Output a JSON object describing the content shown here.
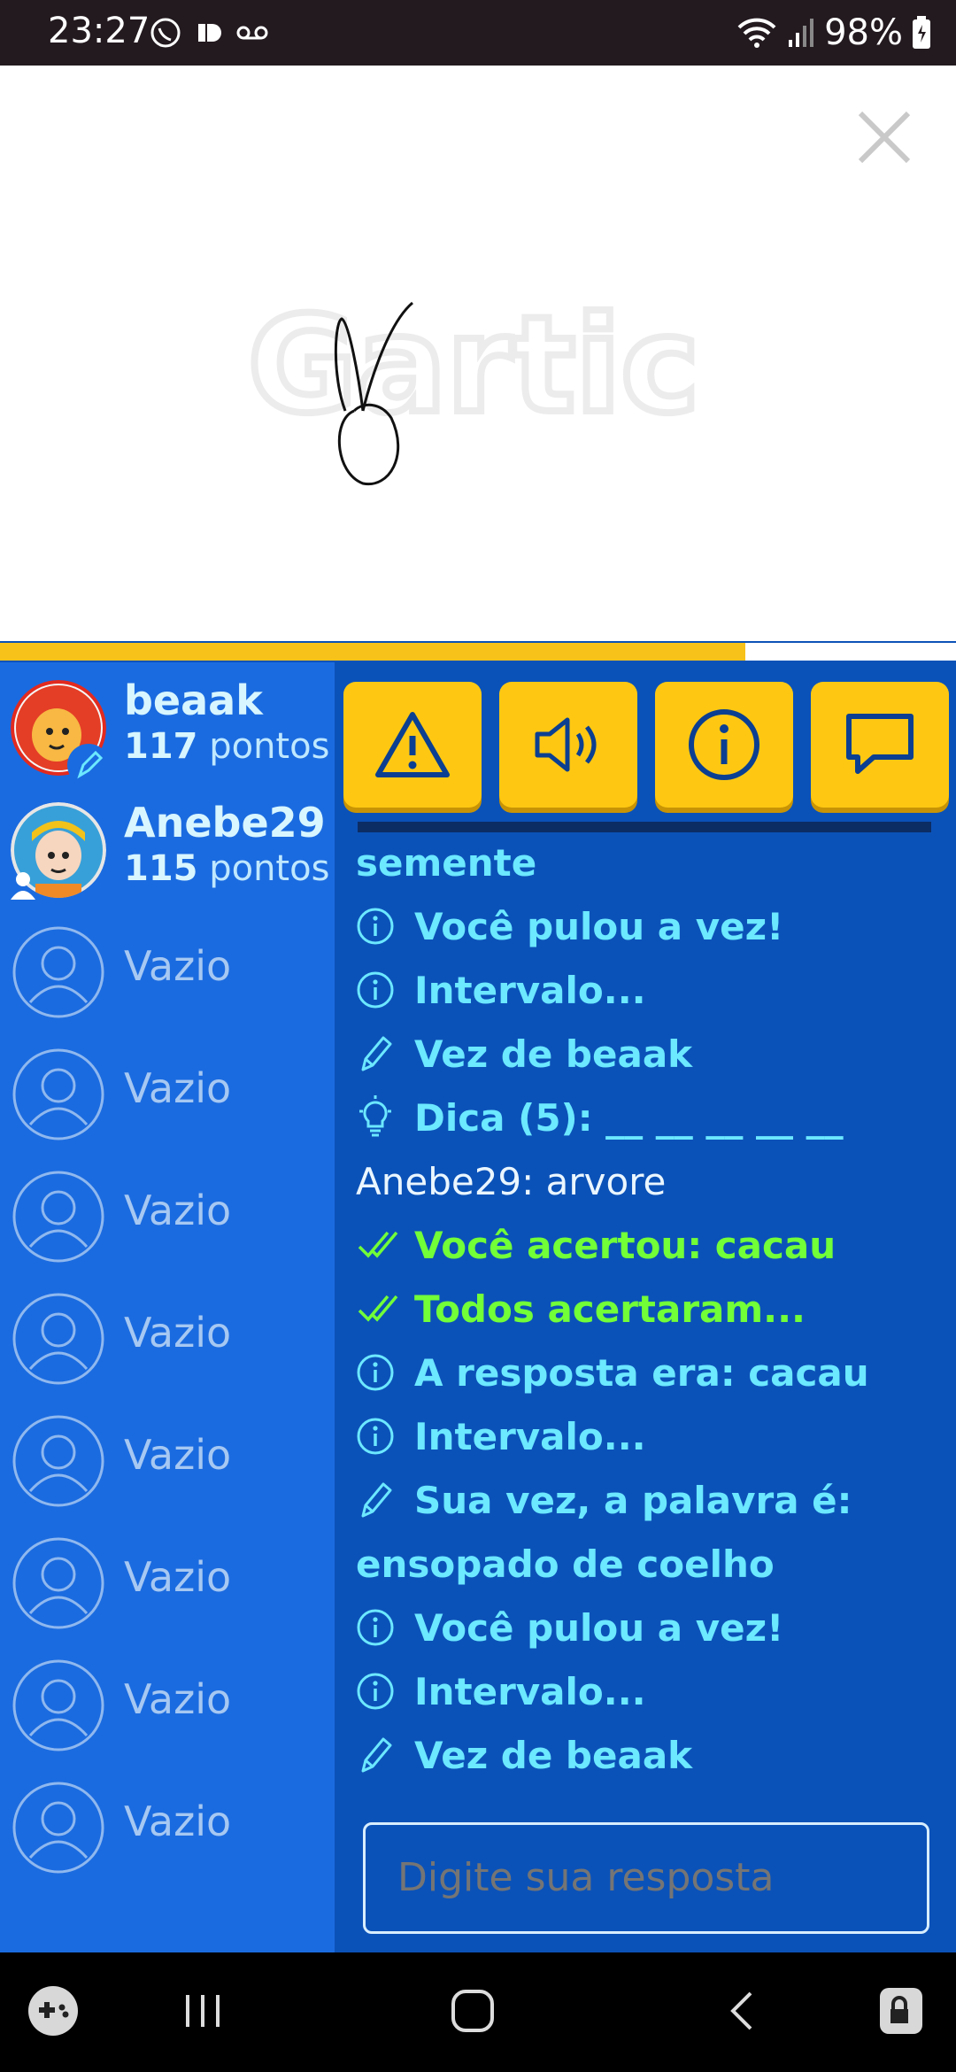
{
  "status_bar": {
    "time": "23:27",
    "battery": "98%"
  },
  "canvas": {
    "watermark": "Gartic"
  },
  "timer": {
    "remaining_fraction": 0.78
  },
  "players": [
    {
      "name": "beaak",
      "score": "117",
      "score_label": "pontos",
      "role": "drawer"
    },
    {
      "name": "Anebe29",
      "score": "115",
      "score_label": "pontos",
      "role": "guesser"
    },
    {
      "name": "Vazio"
    },
    {
      "name": "Vazio"
    },
    {
      "name": "Vazio"
    },
    {
      "name": "Vazio"
    },
    {
      "name": "Vazio"
    },
    {
      "name": "Vazio"
    },
    {
      "name": "Vazio"
    },
    {
      "name": "Vazio"
    }
  ],
  "toolbar": {
    "buttons": [
      "warning-icon",
      "sound-icon",
      "info-icon",
      "chat-icon"
    ]
  },
  "chat": {
    "messages": [
      {
        "icon": "",
        "text": "semente",
        "style": "cont"
      },
      {
        "icon": "info",
        "text": "Você pulou a vez!"
      },
      {
        "icon": "info",
        "text": "Intervalo..."
      },
      {
        "icon": "pencil",
        "text": "Vez de beaak"
      },
      {
        "icon": "bulb",
        "text": "Dica (5): __ __ __ __ __"
      },
      {
        "icon": "",
        "text": "Anebe29: arvore",
        "style": "plain"
      },
      {
        "icon": "check",
        "text": "Você acertou: cacau",
        "style": "green"
      },
      {
        "icon": "check",
        "text": "Todos acertaram...",
        "style": "green"
      },
      {
        "icon": "info",
        "text": "A resposta era: cacau"
      },
      {
        "icon": "info",
        "text": "Intervalo..."
      },
      {
        "icon": "pencil",
        "text": "Sua vez, a palavra é:"
      },
      {
        "icon": "",
        "text": "ensopado de coelho",
        "style": "cont"
      },
      {
        "icon": "info",
        "text": "Você pulou a vez!"
      },
      {
        "icon": "info",
        "text": "Intervalo..."
      },
      {
        "icon": "pencil",
        "text": "Vez de beaak"
      }
    ]
  },
  "answer": {
    "placeholder": "Digite sua resposta"
  }
}
